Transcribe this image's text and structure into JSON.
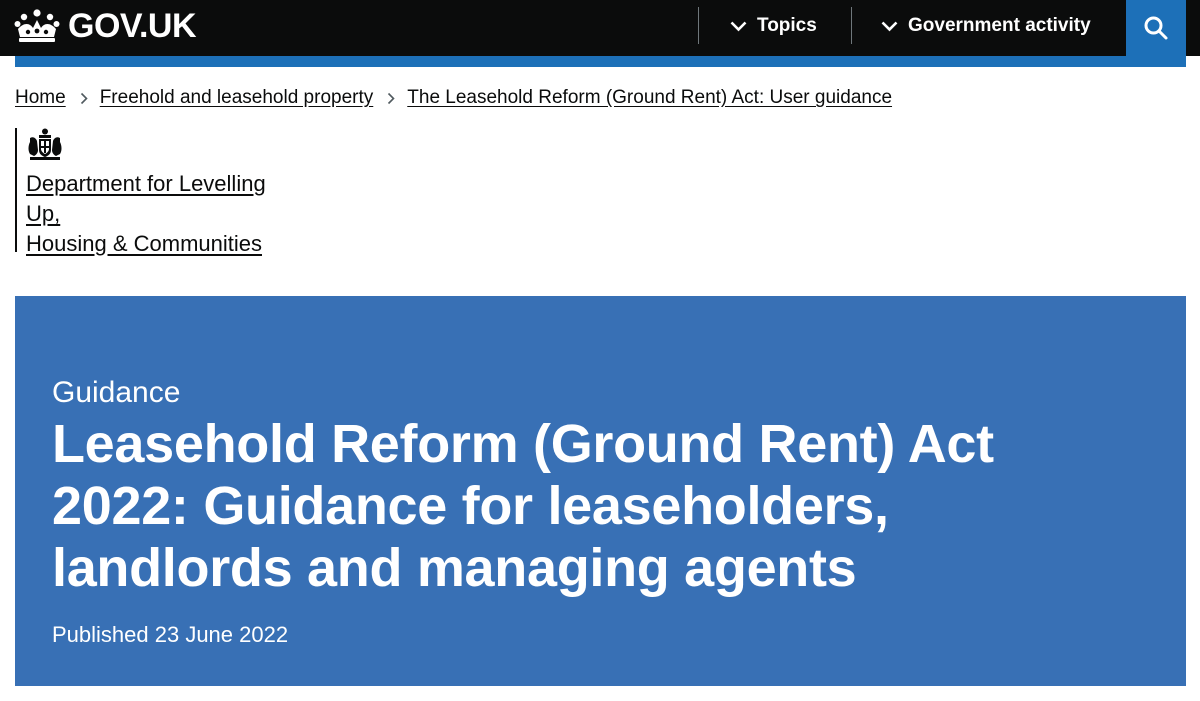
{
  "header": {
    "logo_text": "GOV.UK",
    "nav": [
      {
        "label": "Topics"
      },
      {
        "label": "Government activity"
      }
    ],
    "colors": {
      "background": "#0b0c0c",
      "accent": "#1d70b8"
    }
  },
  "breadcrumb": {
    "items": [
      {
        "label": "Home"
      },
      {
        "label": "Freehold and leasehold property"
      },
      {
        "label": "The Leasehold Reform (Ground Rent) Act: User guidance"
      }
    ]
  },
  "organisation": {
    "name_line1": "Department for Levelling",
    "name_line2": "Up,",
    "name_line3": "Housing & Communities"
  },
  "hero": {
    "context": "Guidance",
    "title": "Leasehold Reform (Ground Rent) Act 2022: Guidance for leaseholders, landlords and managing agents",
    "published": "Published 23 June 2022",
    "background_color": "#3870b5"
  }
}
